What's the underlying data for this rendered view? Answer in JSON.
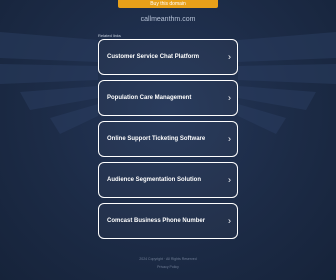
{
  "banner": {
    "label": "Buy this domain"
  },
  "domain": "callmeanthm.com",
  "related_heading": "Related links",
  "links": [
    {
      "label": "Customer Service Chat Platform"
    },
    {
      "label": "Population Care Management"
    },
    {
      "label": "Online Support Ticketing Software"
    },
    {
      "label": "Audience Segmentation Solution"
    },
    {
      "label": "Comcast Business Phone Number"
    }
  ],
  "footer": {
    "line1": "2024 Copyright · All Rights Reserved",
    "line2": "Privacy Policy"
  },
  "colors": {
    "background": "#1b2a44",
    "banner": "#e8a019",
    "button_border": "#ffffff"
  }
}
